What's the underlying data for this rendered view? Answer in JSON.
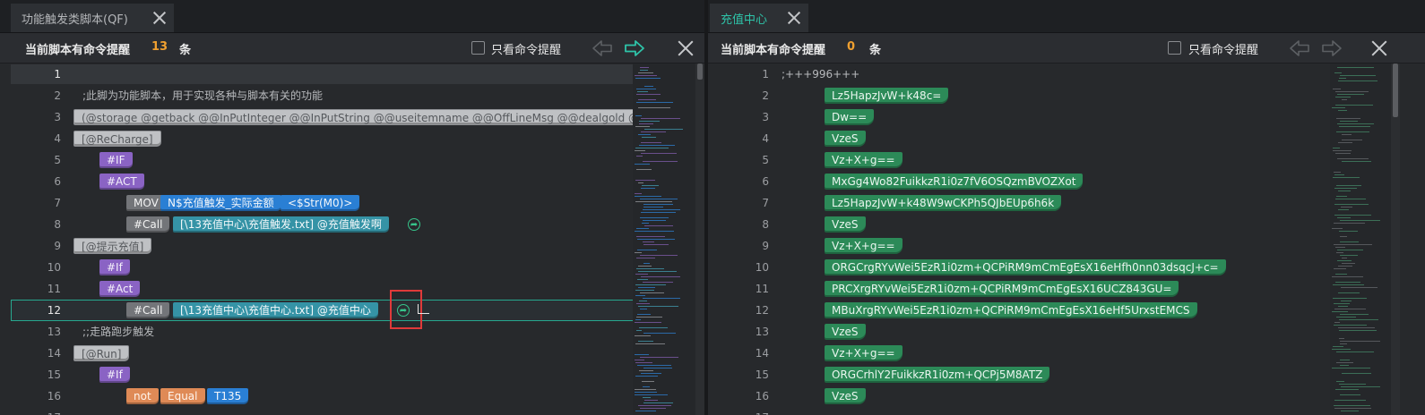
{
  "colors": {
    "accent": "#2ec4a9",
    "count": "#f0a030",
    "highlight_box": "#e03a3a",
    "jump_icon": "#36c48a"
  },
  "left": {
    "tab_title": "功能触发类脚本(QF)",
    "bar": {
      "title": "当前脚本有命令提醒",
      "count": "13",
      "unit": "条",
      "checkbox_label": "只看命令提醒",
      "checkbox_checked": false
    },
    "current_line": 12,
    "lines": [
      {
        "n": "1",
        "segs": []
      },
      {
        "n": "2",
        "comment": ";此脚为功能脚本，用于实现各种与脚本有关的功能"
      },
      {
        "n": "3",
        "segs": [
          {
            "t": "(@storage @getback @@InPutInteger @@InPutString @@useitemname @@OffLineMsg @@dealgold @MUZHUANG @OnKi",
            "c": "g-label"
          }
        ]
      },
      {
        "n": "4",
        "segs": [
          {
            "t": "[@ReCharge]",
            "c": "g-label"
          }
        ]
      },
      {
        "n": "5",
        "segs": [
          {
            "t": "#IF",
            "c": "g-kw"
          }
        ]
      },
      {
        "n": "6",
        "segs": [
          {
            "t": "#ACT",
            "c": "g-kw"
          }
        ]
      },
      {
        "n": "7",
        "segs": [
          {
            "t": "MOV",
            "c": "g-op"
          },
          {
            "t": "N$充值触发_实际金额",
            "c": "g-str"
          },
          {
            "t": "<$Str(M0)>",
            "c": "g-str"
          }
        ]
      },
      {
        "n": "8",
        "segs": [
          {
            "t": "#Call",
            "c": "g-op"
          },
          {
            "t": "[\\13充值中心\\充值触发.txt] @充值触发啊",
            "c": "g-file"
          }
        ],
        "jump": true
      },
      {
        "n": "9",
        "segs": [
          {
            "t": "[@提示充值]",
            "c": "g-label"
          }
        ]
      },
      {
        "n": "10",
        "segs": [
          {
            "t": "#If",
            "c": "g-kw"
          }
        ]
      },
      {
        "n": "11",
        "segs": [
          {
            "t": "#Act",
            "c": "g-kw"
          }
        ]
      },
      {
        "n": "12",
        "segs": [
          {
            "t": "#Call",
            "c": "g-op"
          },
          {
            "t": "[\\13充值中心\\充值中心.txt] @充值中心",
            "c": "g-file"
          }
        ],
        "jump": true,
        "enter": true
      },
      {
        "n": "13",
        "comment": ";;走路跑步触发"
      },
      {
        "n": "14",
        "segs": [
          {
            "t": "[@Run]",
            "c": "g-label"
          }
        ]
      },
      {
        "n": "15",
        "segs": [
          {
            "t": "#If",
            "c": "g-kw"
          }
        ]
      },
      {
        "n": "16",
        "segs": [
          {
            "t": "not",
            "c": "g-or"
          },
          {
            "t": "Equal",
            "c": "g-or"
          },
          {
            "t": "T135",
            "c": "g-str"
          }
        ]
      },
      {
        "n": "17",
        "segs": []
      }
    ]
  },
  "right": {
    "tab_title": "充值中心",
    "bar": {
      "title": "当前脚本有命令提醒",
      "count": "0",
      "unit": "条",
      "checkbox_label": "只看命令提醒",
      "checkbox_checked": false
    },
    "lines": [
      {
        "n": "1",
        "comment": ";+++996+++"
      },
      {
        "n": "2",
        "segs": [
          {
            "t": "Lz5HapzJvW+k48c=",
            "c": "g-gr"
          }
        ]
      },
      {
        "n": "3",
        "segs": [
          {
            "t": "Dw==",
            "c": "g-gr"
          }
        ]
      },
      {
        "n": "4",
        "segs": [
          {
            "t": "VzeS",
            "c": "g-gr"
          }
        ]
      },
      {
        "n": "5",
        "segs": [
          {
            "t": "Vz+X+g==",
            "c": "g-gr"
          }
        ]
      },
      {
        "n": "6",
        "segs": [
          {
            "t": "MxGg4Wo82FuikkzR1i0z7fV6OSQzmBVOZXot",
            "c": "g-gr"
          }
        ]
      },
      {
        "n": "7",
        "segs": [
          {
            "t": "Lz5HapzJvW+k48W9wCKPh5QJbEUp6h6k",
            "c": "g-gr"
          }
        ]
      },
      {
        "n": "8",
        "segs": [
          {
            "t": "VzeS",
            "c": "g-gr"
          }
        ]
      },
      {
        "n": "9",
        "segs": [
          {
            "t": "Vz+X+g==",
            "c": "g-gr"
          }
        ]
      },
      {
        "n": "10",
        "segs": [
          {
            "t": "ORGCrgRYvWei5EzR1i0zm+QCPiRM9mCmEgEsX16eHfh0nn03dsqcJ+c=",
            "c": "g-gr"
          }
        ]
      },
      {
        "n": "11",
        "segs": [
          {
            "t": "PRCXrgRYvWei5EzR1i0zm+QCPiRM9mCmEgEsX16UCZ843GU=",
            "c": "g-gr"
          }
        ]
      },
      {
        "n": "12",
        "segs": [
          {
            "t": "MBuXrgRYvWei5EzR1i0zm+QCPiRM9mCmEgEsX16eHf5UrxstEMCS",
            "c": "g-gr"
          }
        ]
      },
      {
        "n": "13",
        "segs": [
          {
            "t": "VzeS",
            "c": "g-gr"
          }
        ]
      },
      {
        "n": "14",
        "segs": [
          {
            "t": "Vz+X+g==",
            "c": "g-gr"
          }
        ]
      },
      {
        "n": "15",
        "segs": [
          {
            "t": "ORGCrhlY2FuikkzR1i0zm+QCPj5M8ATZ",
            "c": "g-gr"
          }
        ]
      },
      {
        "n": "16",
        "segs": [
          {
            "t": "VzeS",
            "c": "g-gr"
          }
        ]
      },
      {
        "n": "17",
        "segs": []
      }
    ]
  }
}
